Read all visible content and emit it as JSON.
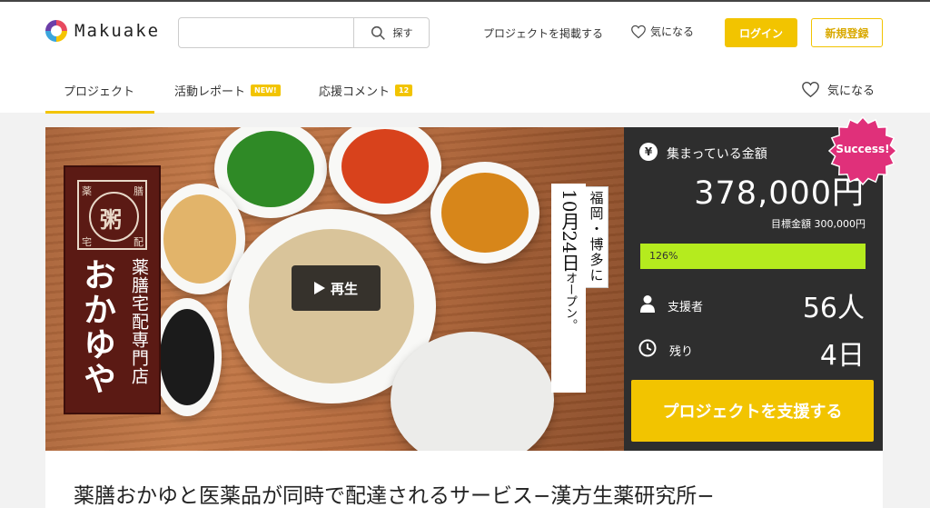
{
  "brand": {
    "logo_text": "Makuake"
  },
  "header": {
    "search_placeholder": "",
    "search_button": "探す",
    "post_project": "プロジェクトを掲載する",
    "favorites": "気になる",
    "login": "ログイン",
    "signup": "新規登録"
  },
  "tabs": [
    {
      "label": "プロジェクト",
      "active": true
    },
    {
      "label": "活動レポート",
      "badge": "NEW!"
    },
    {
      "label": "応援コメント",
      "badge": "12"
    }
  ],
  "tab_favorite": "気になる",
  "hero": {
    "play_label": "再生",
    "shop_seal_chars": [
      "薬",
      "膳",
      "宅",
      "配"
    ],
    "shop_seal_center": "粥",
    "shop_name": "おかゆや",
    "shop_subtitle": "薬膳宅配専門店",
    "banner_location": "福岡・博多に",
    "banner_date": "10月24日",
    "banner_open": "オープン。"
  },
  "funding": {
    "raised_label": "集まっている金額",
    "raised_amount": "378,000円",
    "goal_text": "目標金額 300,000円",
    "progress_percent": 126,
    "progress_label": "126%",
    "supporters_label": "支援者",
    "supporters_value": "56人",
    "remaining_label": "残り",
    "remaining_value": "4日",
    "support_button": "プロジェクトを支援する",
    "status_badge": "Success!",
    "currency_icon": "yen-icon",
    "accent_color": "#f2c400",
    "progress_color": "#b5eb1e",
    "badge_color": "#e0307a"
  },
  "project_title": "薬膳おかゆと医薬品が同時で配達されるサービス−漢方生薬研究所−"
}
